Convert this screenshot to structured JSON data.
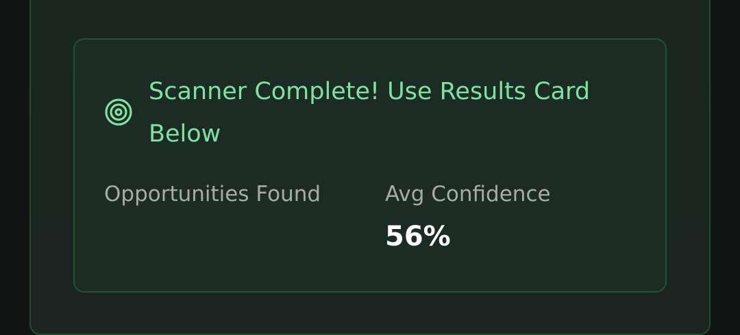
{
  "scanner": {
    "status_title": "Scanner Complete! Use Results Card Below",
    "status_icon": "target-icon",
    "accent_color": "#7ee3a2"
  },
  "stats": {
    "opportunities_label": "Opportunities Found",
    "confidence_label": "Avg Confidence",
    "confidence_value": "56%"
  }
}
